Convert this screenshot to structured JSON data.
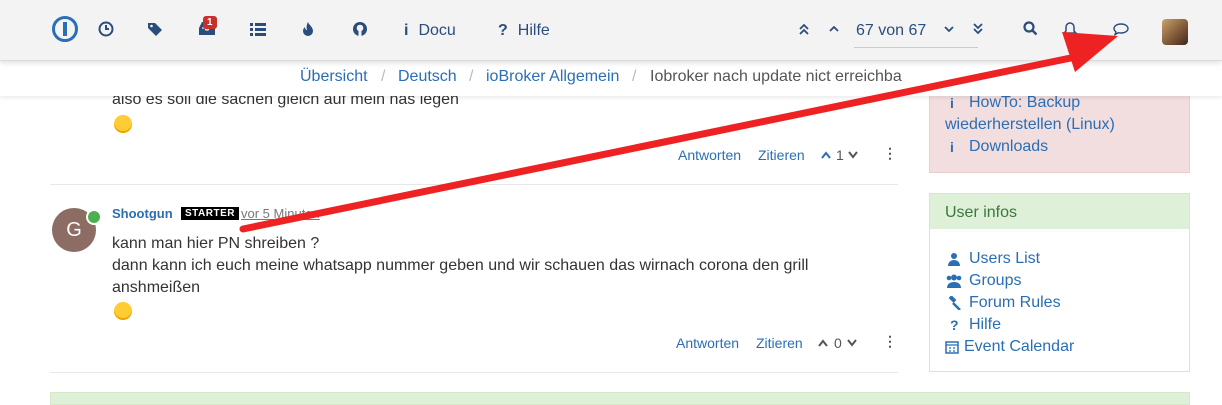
{
  "navbar": {
    "notifications_count": "1",
    "docu_label": "Docu",
    "hilfe_label": "Hilfe",
    "pagination": "67 von 67"
  },
  "breadcrumb": {
    "items": [
      "Übersicht",
      "Deutsch",
      "ioBroker Allgemein",
      "Iobroker nach update nict erreichba"
    ]
  },
  "posts": [
    {
      "text_lines": [
        "also es soll die sachen gleich auf mein nas legen"
      ],
      "actions": {
        "reply": "Antworten",
        "quote": "Zitieren"
      },
      "votes": "1"
    },
    {
      "avatar_letter": "G",
      "username": "Shootgun",
      "badge": "STARTER",
      "time": "vor 5 Minuten",
      "text_lines": [
        "kann man hier PN shreiben ?",
        "dann kann ich euch meine whatsapp nummer geben und wir schauen das wirnach corona den grill",
        "anshmeißen"
      ],
      "actions": {
        "reply": "Antworten",
        "quote": "Zitieren"
      },
      "votes": "0"
    }
  ],
  "sidebar": {
    "red_links": [
      "HowTo: Backup",
      "wiederherstellen (Linux)",
      "Downloads"
    ],
    "user_infos": {
      "title": "User infos",
      "links": [
        "Users List",
        "Groups",
        "Forum Rules",
        "Hilfe",
        "Event Calendar"
      ]
    }
  },
  "colors": {
    "link": "#2a6eb5",
    "annotation_arrow": "#ee2222",
    "panel_red_bg": "#f2dede",
    "panel_green_bg": "#dff0d8"
  },
  "icons": [
    "recent-icon",
    "tags-icon",
    "inbox-icon",
    "list-icon",
    "fire-icon",
    "github-icon",
    "info-icon",
    "question-icon",
    "search-icon",
    "bell-icon",
    "chat-icon",
    "info-icon",
    "users-icon",
    "group-icon",
    "gavel-icon",
    "calendar-icon"
  ]
}
